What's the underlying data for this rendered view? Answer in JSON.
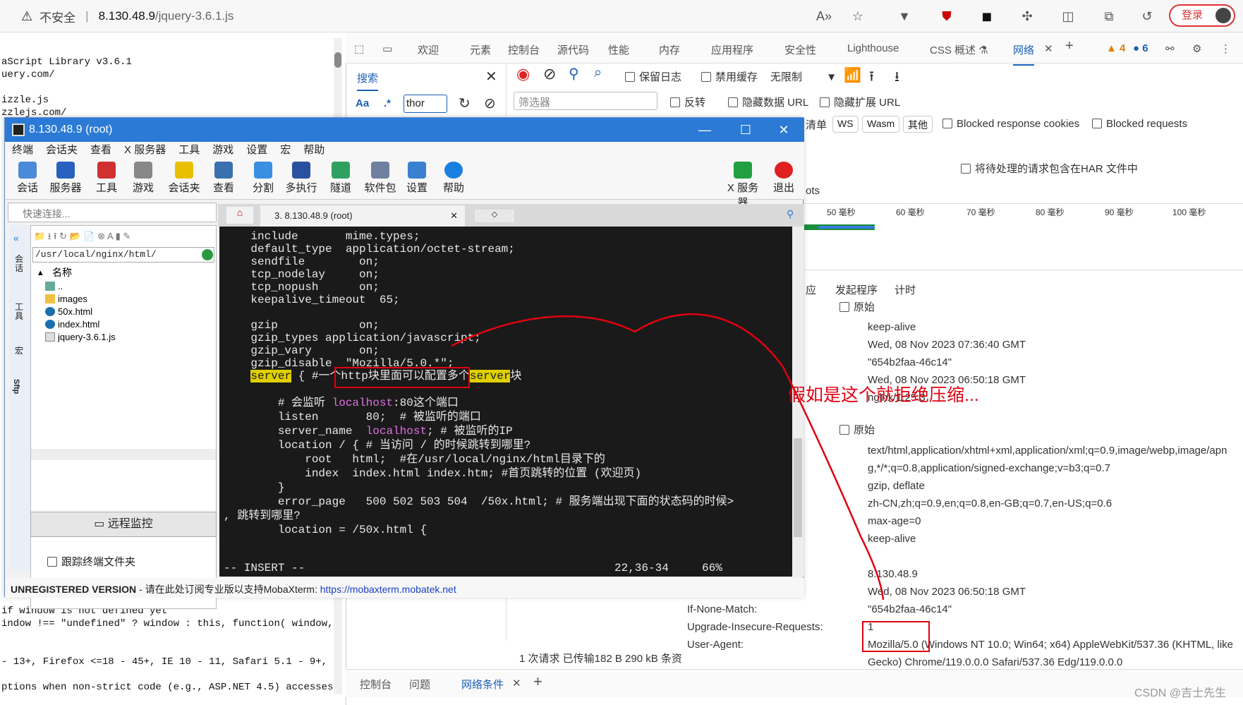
{
  "browser": {
    "not_secure": "不安全",
    "host": "8.130.48.9",
    "path": "/jquery-3.6.1.js",
    "login": "登录"
  },
  "source_lines": [
    "aScript Library v3.6.1",
    "uery.com/",
    "",
    "izzle.js",
    "zzlejs.com/"
  ],
  "source_lines_bottom": [
    "if window is not defined yet",
    "indow !== \"undefined\" ? window : this, function( window,",
    "",
    "- 13+, Firefox <=18 - 45+, IE 10 - 11, Safari 5.1 - 9+,",
    "",
    "ptions when non-strict code (e.g., ASP.NET 4.5) accesses"
  ],
  "devtools": {
    "tabs": [
      "欢迎",
      "元素",
      "控制台",
      "源代码",
      "性能",
      "内存",
      "应用程序",
      "安全性",
      "Lighthouse",
      "CSS 概述 ⚗",
      "网络"
    ],
    "warn_count": "4",
    "msg_count": "6",
    "search_tab": "搜索",
    "aa": "Aa",
    "regex": ".*",
    "search_value": "thor",
    "preserve_log": "保留日志",
    "disable_cache": "禁用缓存",
    "throttle": "无限制",
    "filter_placeholder": "筛选器",
    "invert": "反转",
    "hide_data_urls": "隐藏数据 URL",
    "hide_ext_urls": "隐藏扩展 URL",
    "chips_partial": "清单",
    "chips": [
      "WS",
      "Wasm",
      "其他"
    ],
    "blocked_cookies": "Blocked response cookies",
    "blocked_requests": "Blocked requests",
    "har_text": "将待处理的请求包含在HAR 文件中",
    "partial_ots": "ots",
    "ticks": [
      "50 毫秒",
      "60 毫秒",
      "70 毫秒",
      "80 毫秒",
      "90 毫秒",
      "100 毫秒"
    ],
    "detail_tabs": [
      "应",
      "发起程序",
      "计时"
    ],
    "raw": "原始",
    "resp_values": [
      "keep-alive",
      "Wed, 08 Nov 2023 07:36:40 GMT",
      "\"654b2faa-46c14\"",
      "Wed, 08 Nov 2023 06:50:18 GMT",
      "nginx/1.25.3"
    ],
    "req_values": [
      "text/html,application/xhtml+xml,application/xml;q=0.9,image/webp,image/apn",
      "g,*/*;q=0.8,application/signed-exchange;v=b3;q=0.7",
      "gzip, deflate",
      "zh-CN,zh;q=0.9,en;q=0.8,en-GB;q=0.7,en-US;q=0.6",
      "max-age=0",
      "keep-alive",
      "",
      "8.130.48.9",
      "Wed, 08 Nov 2023 06:50:18 GMT",
      "\"654b2faa-46c14\"",
      "1",
      "Mozilla/5.0 (Windows NT 10.0; Win64; x64) AppleWebKit/537.36 (KHTML, like",
      "Gecko) Chrome/119.0.0.0 Safari/537.36 Edg/119.0.0.0"
    ],
    "req_names": {
      "inm": "If-None-Match:",
      "uir": "Upgrade-Insecure-Requests:",
      "ua": "User-Agent:"
    },
    "status": "1 次请求  已传输182 B  290 kB 条资",
    "bottom_tabs": [
      "控制台",
      "问题",
      "网络条件"
    ]
  },
  "moba": {
    "title": "8.130.48.9 (root)",
    "menu": [
      "终端",
      "会话夹",
      "查看",
      "X 服务器",
      "工具",
      "游戏",
      "设置",
      "宏",
      "帮助"
    ],
    "tools": [
      "会话",
      "服务器",
      "工具",
      "游戏",
      "会话夹",
      "查看",
      "分割",
      "多执行",
      "隧道",
      "软件包",
      "设置",
      "帮助"
    ],
    "xserver": "X 服务器",
    "exit": "退出",
    "quick": "快速连接...",
    "session_tab": "3. 8.130.48.9 (root)",
    "path": "/usr/local/nginx/html/",
    "col_name": "名称",
    "files": [
      "..",
      "images",
      "50x.html",
      "index.html",
      "jquery-3.6.1.js"
    ],
    "remote": "远程监控",
    "follow": "跟踪终端文件夹",
    "vtabs": [
      "会话",
      "工具",
      "宏",
      "Sftp"
    ],
    "unreg_bold": "UNREGISTERED VERSION",
    "unreg_text": " - 请在此处订阅专业版以支持MobaXterm: ",
    "unreg_link": "https://mobaxterm.mobatek.net"
  },
  "terminal": [
    "    include       mime.types;",
    "    default_type  application/octet-stream;",
    "    sendfile        on;",
    "    tcp_nodelay     on;",
    "    tcp_nopush      on;",
    "    keepalive_timeout  65;",
    "",
    "    gzip            on;",
    "    gzip_types application/javascript;",
    "    gzip_vary       on;",
    "    gzip_disable  \"Mozilla/5.0.*\";"
  ],
  "terminal_server": {
    "kw": "server",
    "mid": " { #一个http块里面可以配置多个",
    "tail": "块"
  },
  "terminal_rest": [
    "",
    "        # 会监听 |localhost|:80这个端口",
    "        listen       80;  # 被监听的端口",
    "        server_name  |localhost|; # 被监听的IP",
    "        location / { # 当访问 / 的时候跳转到哪里?",
    "            root   html;  #在/usr/local/nginx/html目录下的",
    "            index  index.html index.htm; #首页跳转的位置 (欢迎页)",
    "        }",
    "        error_page   500 502 503 504  /50x.html; # 服务端出现下面的状态码的时候>",
    ", 跳转到哪里?",
    "        location = /50x.html {"
  ],
  "status_line": {
    "mode": "-- INSERT --",
    "pos": "22,36-34",
    "pct": "66%"
  },
  "annotation": "假如是这个就拒绝压缩...",
  "watermark": "CSDN @吉士先生",
  "colors": {
    "accent": "#1a5fb4",
    "annotation": "#e00010",
    "title": "#2a7ad6"
  }
}
